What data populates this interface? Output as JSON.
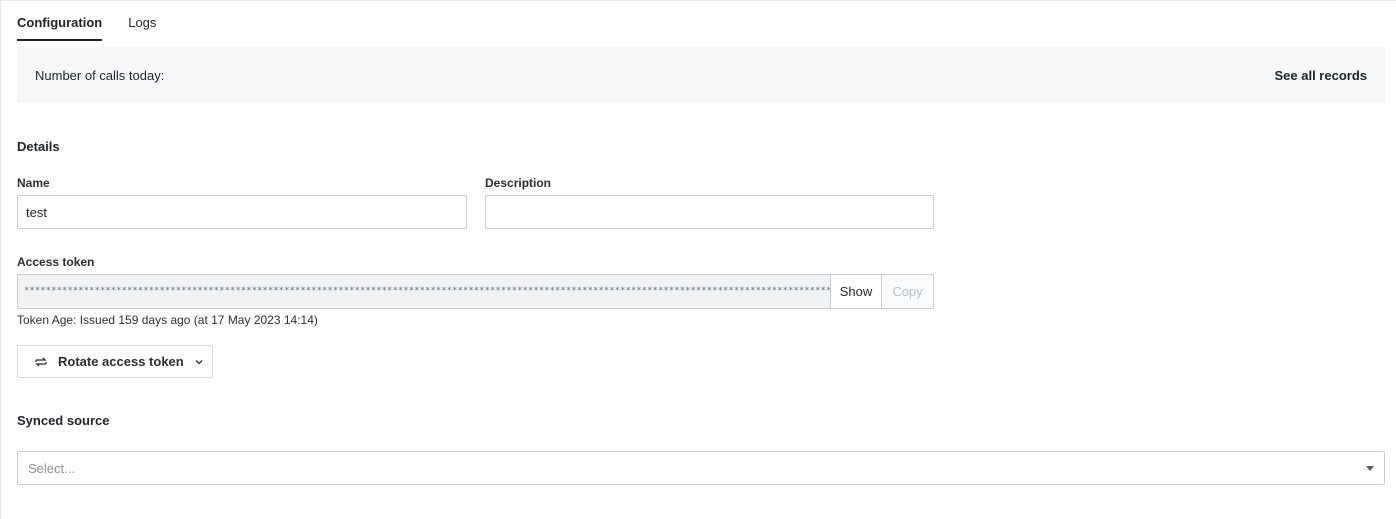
{
  "tabs": [
    {
      "label": "Configuration",
      "active": true
    },
    {
      "label": "Logs",
      "active": false
    }
  ],
  "summary": {
    "calls_label": "Number of calls today:",
    "see_all_link": "See all records"
  },
  "details": {
    "title": "Details",
    "name_label": "Name",
    "name_value": "test",
    "description_label": "Description",
    "description_value": "",
    "access_token_label": "Access token",
    "access_token_masked": "**********************************************************************************************************************************************************************************************************************************************",
    "show_label": "Show",
    "copy_label": "Copy",
    "token_age": "Token Age: Issued 159 days ago (at 17 May 2023 14:14)",
    "rotate_label": "Rotate access token",
    "rotate_icon": "rotate-arrows-icon",
    "rotate_chevron_icon": "chevron-down-icon"
  },
  "synced_source": {
    "title": "Synced source",
    "placeholder": "Select...",
    "caret_icon": "caret-down-icon"
  },
  "colors": {
    "summary_bg": "#f6f7f9",
    "border": "#c7ccd1",
    "text": "#1f2328",
    "muted": "#8a9098"
  }
}
